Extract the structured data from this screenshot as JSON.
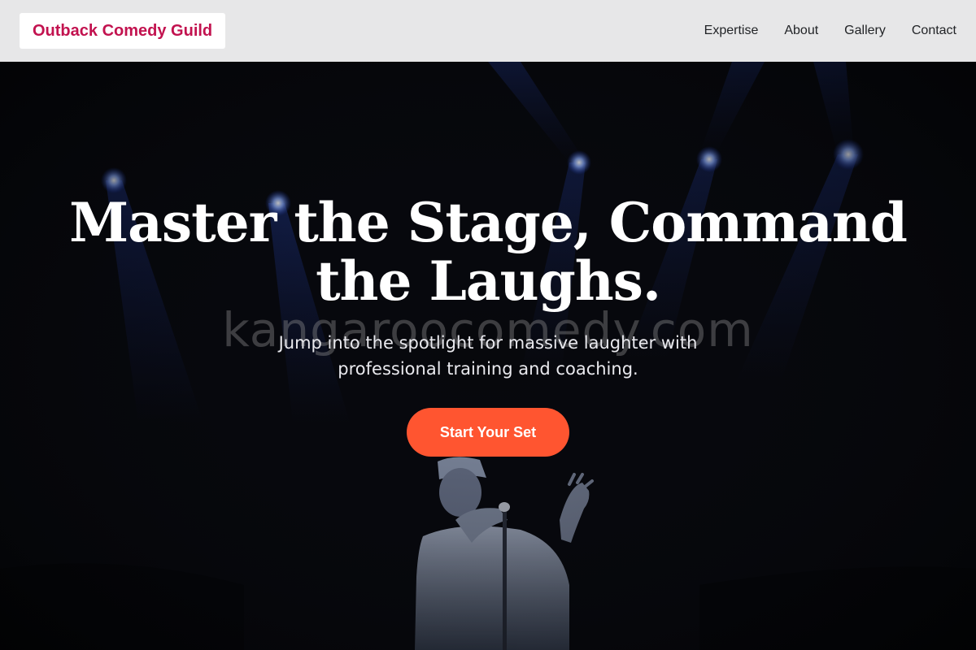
{
  "header": {
    "logo": "Outback Comedy Guild",
    "nav": [
      {
        "label": "Expertise"
      },
      {
        "label": "About"
      },
      {
        "label": "Gallery"
      },
      {
        "label": "Contact"
      }
    ]
  },
  "hero": {
    "title": "Master the Stage, Command the Laughs.",
    "watermark": "kangaroocomedy.com",
    "subtitle": "Jump into the spotlight for massive laughter with professional training and coaching.",
    "cta_label": "Start Your Set"
  },
  "colors": {
    "logo": "#c2124f",
    "cta": "#ff5530",
    "header_bg": "#e7e7e8",
    "hero_bg": "#050608",
    "spotlight": "#3b5bd6"
  }
}
